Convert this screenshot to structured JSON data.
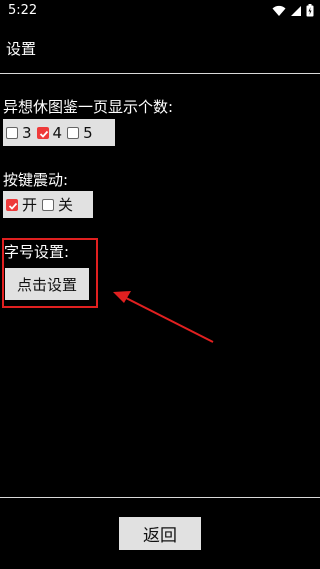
{
  "status_bar": {
    "time": "5:22",
    "icons": [
      "wifi-icon",
      "signal-icon",
      "battery-icon"
    ]
  },
  "header": {
    "title": "设置"
  },
  "items_per_page": {
    "label": "异想休图鉴一页显示个数:",
    "options": [
      {
        "label": "3",
        "checked": false
      },
      {
        "label": "4",
        "checked": true
      },
      {
        "label": "5",
        "checked": false
      }
    ]
  },
  "button_vibration": {
    "label": "按键震动:",
    "options": [
      {
        "label": "开",
        "checked": true
      },
      {
        "label": "关",
        "checked": false
      }
    ]
  },
  "font_size": {
    "label": "字号设置:",
    "button_label": "点击设置"
  },
  "footer": {
    "back_label": "返回"
  },
  "colors": {
    "checkbox_checked": "#ee3a3a",
    "highlight_box": "#e12020",
    "arrow": "#e12020",
    "button_bg": "#e1e1e1"
  }
}
